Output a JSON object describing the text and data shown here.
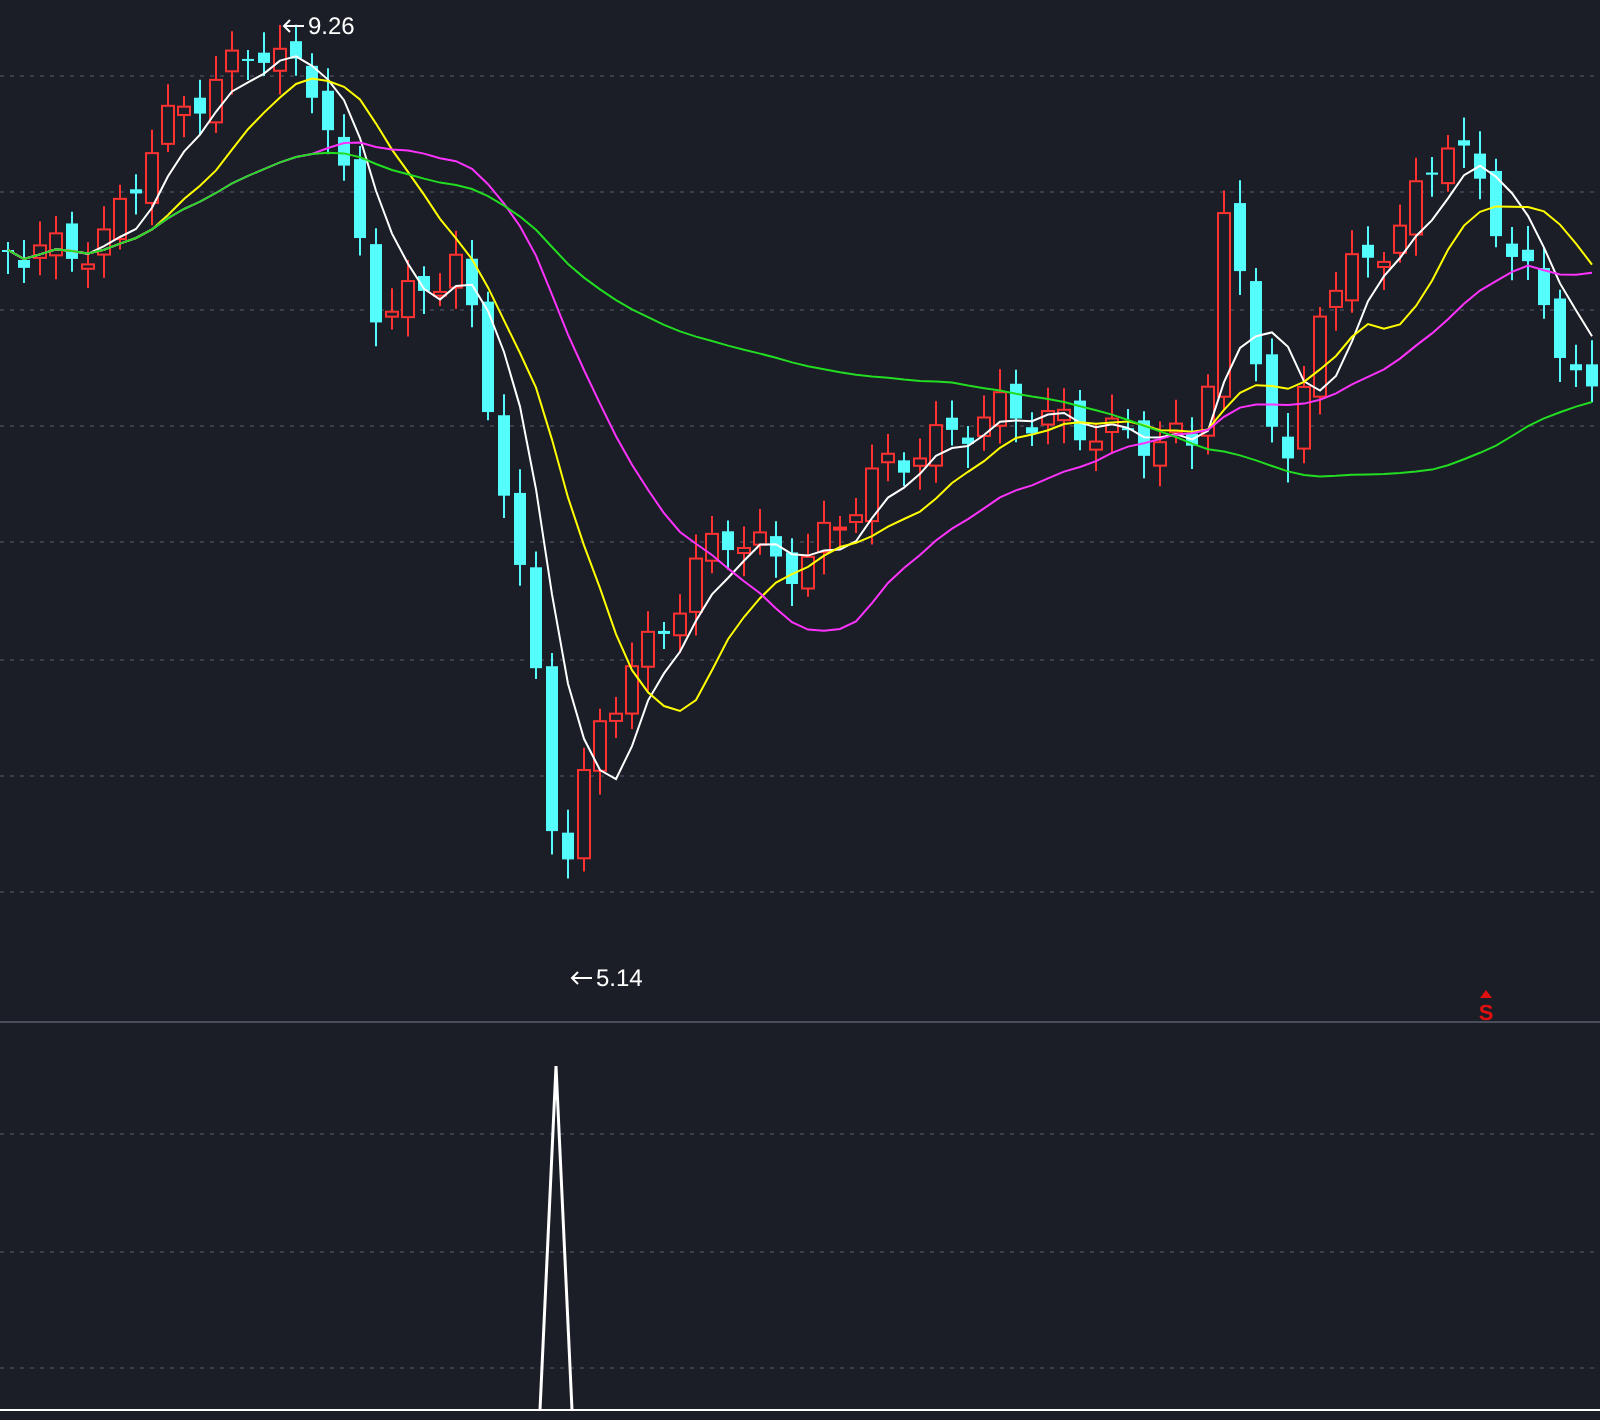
{
  "price_labels": [
    {
      "kind": "high",
      "text": "9.26"
    },
    {
      "kind": "low",
      "text": "5.14"
    }
  ],
  "signal": {
    "text": "S"
  }
}
